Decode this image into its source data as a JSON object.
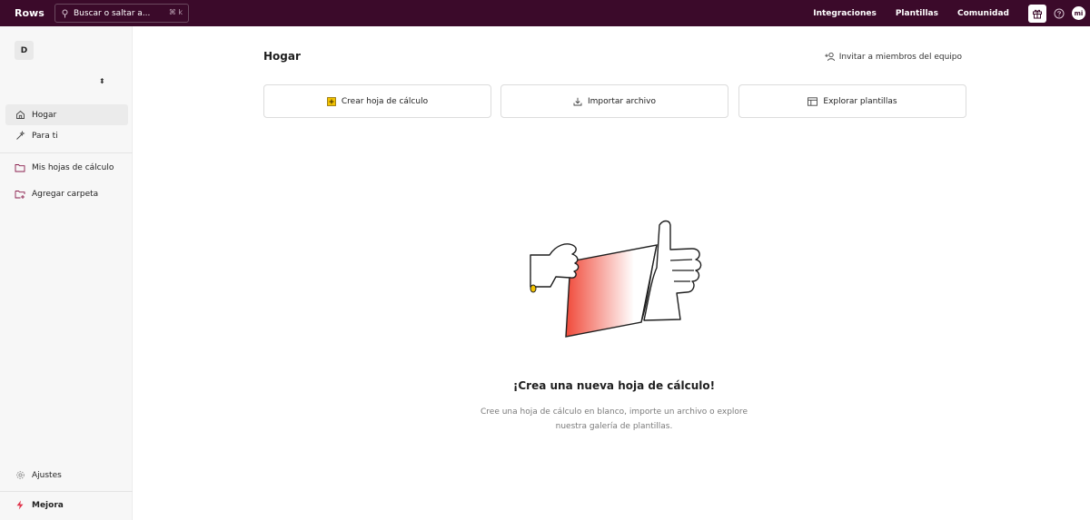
{
  "app": {
    "name": "Rows"
  },
  "search": {
    "placeholder": "Buscar o saltar a...",
    "shortcut": "⌘ k"
  },
  "topnav": {
    "links": [
      "Integraciones",
      "Plantillas",
      "Comunidad"
    ],
    "avatar_initials": "mi"
  },
  "sidebar": {
    "workspace_initial": "D",
    "workspace_caret": "⬍",
    "items": [
      {
        "label": "Hogar",
        "icon": "home-icon",
        "active": true
      },
      {
        "label": "Para ti",
        "icon": "magic-wand-icon",
        "active": false
      },
      {
        "label": "Mis hojas de cálculo",
        "icon": "folder-icon",
        "active": false
      },
      {
        "label": "Agregar carpeta",
        "icon": "folder-plus-icon",
        "active": false
      }
    ],
    "settings_label": "Ajustes",
    "upgrade_label": "Mejora"
  },
  "main": {
    "title": "Hogar",
    "invite_label": "Invitar a miembros del equipo",
    "actions": [
      {
        "label": "Crear hoja de cálculo",
        "icon": "spreadsheet-plus-icon"
      },
      {
        "label": "Importar archivo",
        "icon": "download-icon"
      },
      {
        "label": "Explorar plantillas",
        "icon": "template-icon"
      }
    ],
    "empty_state": {
      "title": "¡Crea una nueva hoja de cálculo!",
      "description": "Cree una hoja de cálculo en blanco, importe un archivo o explore nuestra galería de plantillas."
    }
  },
  "colors": {
    "topbar": "#3b0a2a",
    "accent_yellow": "#f2c200",
    "accent_red": "#f04a3a",
    "upgrade_icon": "#e0334a"
  }
}
